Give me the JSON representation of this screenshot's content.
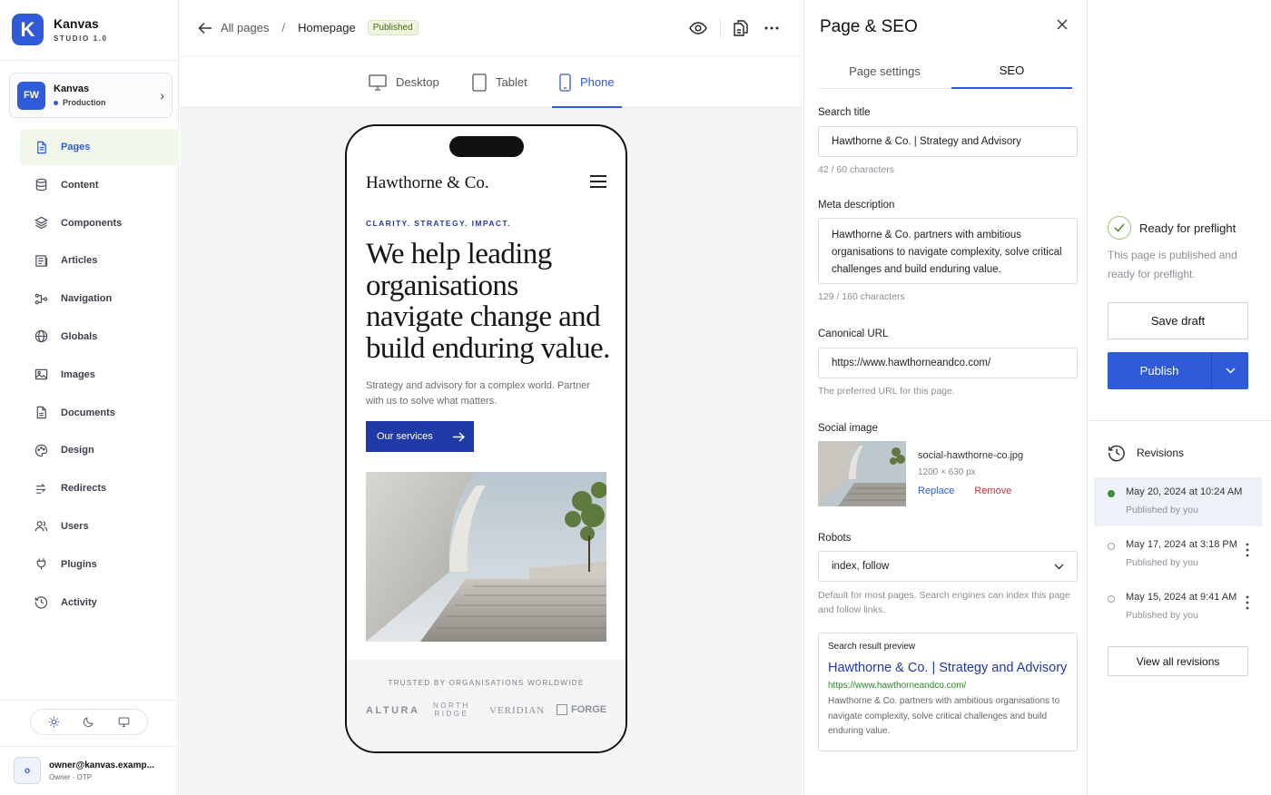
{
  "brand": {
    "logo_letter": "K",
    "name": "Kanvas",
    "version": "STUDIO 1.0"
  },
  "workspace": {
    "initials": "FW",
    "name": "Kanvas",
    "environment": "Production"
  },
  "sidebar": {
    "items": [
      {
        "label": "Pages",
        "icon": "page-icon",
        "active": true
      },
      {
        "label": "Content",
        "icon": "database-icon"
      },
      {
        "label": "Components",
        "icon": "layers-icon"
      },
      {
        "label": "Articles",
        "icon": "newspaper-icon"
      },
      {
        "label": "Navigation",
        "icon": "route-icon"
      },
      {
        "label": "Globals",
        "icon": "globe-icon"
      },
      {
        "label": "Images",
        "icon": "image-icon"
      },
      {
        "label": "Documents",
        "icon": "document-icon"
      },
      {
        "label": "Design",
        "icon": "palette-icon"
      },
      {
        "label": "Redirects",
        "icon": "redirect-icon"
      },
      {
        "label": "Users",
        "icon": "users-icon"
      },
      {
        "label": "Plugins",
        "icon": "plug-icon"
      },
      {
        "label": "Activity",
        "icon": "history-icon"
      }
    ],
    "theme_selected": "light"
  },
  "user": {
    "initial": "o",
    "email": "owner@kanvas.examp...",
    "role": "Owner · OTP"
  },
  "topbar": {
    "all_pages": "All pages",
    "separator": "/",
    "page": "Homepage",
    "status": "Published"
  },
  "devices": {
    "desktop": "Desktop",
    "tablet": "Tablet",
    "phone": "Phone",
    "selected": "phone"
  },
  "site": {
    "logo": "Hawthorne & Co.",
    "eyebrow": "CLARITY. STRATEGY. IMPACT.",
    "headline": "We help leading organisations navigate change and build enduring value.",
    "subtext": "Strategy and advisory for a complex world. Partner with us to solve what matters.",
    "cta": "Our services",
    "trusted_title": "TRUSTED BY ORGANISATIONS WORLDWIDE",
    "clients": {
      "c1": "ALTURA",
      "c2a": "NORTH",
      "c2b": "RIDGE",
      "c3": "VERIDIAN",
      "c4": "FORGE"
    }
  },
  "seo_panel": {
    "title": "Page & SEO",
    "tabs": {
      "page_settings": "Page settings",
      "seo": "SEO",
      "selected": "seo"
    },
    "search_title": {
      "label": "Search title",
      "value": "Hawthorne & Co. | Strategy and Advisory",
      "count": "42 / 60 characters"
    },
    "meta_description": {
      "label": "Meta description",
      "value": "Hawthorne & Co. partners with ambitious organisations to navigate complexity, solve critical challenges and build enduring value.",
      "count": "129 / 160 characters"
    },
    "canonical": {
      "label": "Canonical URL",
      "value": "https://www.hawthorneandco.com/",
      "help": "The preferred URL for this page."
    },
    "social": {
      "label": "Social image",
      "filename": "social-hawthorne-co.jpg",
      "size": "1200 × 630 px",
      "replace": "Replace",
      "remove": "Remove"
    },
    "robots": {
      "label": "Robots",
      "value": "index, follow",
      "help": "Default for most pages. Search engines can index this page and follow links."
    },
    "preview": {
      "label": "Search result preview",
      "title": "Hawthorne & Co. | Strategy and Advisory",
      "url": "https://www.hawthorneandco.com/",
      "desc": "Hawthorne & Co. partners with ambitious organisations to navigate complexity, solve critical challenges and build enduring value."
    }
  },
  "publish": {
    "status_title": "Ready for preflight",
    "status_desc": "This page is published and ready for preflight.",
    "save_draft": "Save draft",
    "publish": "Publish",
    "revisions_title": "Revisions",
    "revisions": [
      {
        "date": "May 20, 2024 at 10:24 AM",
        "by": "Published by you",
        "current": true
      },
      {
        "date": "May 17, 2024 at 3:18 PM",
        "by": "Published by you"
      },
      {
        "date": "May 15, 2024 at 9:41 AM",
        "by": "Published by you"
      }
    ],
    "view_all": "View all revisions"
  },
  "colors": {
    "accent": "#2f5bd8",
    "site_blue": "#1f3aa6",
    "published_bg": "#eef6df",
    "remove_red": "#c5303a"
  }
}
